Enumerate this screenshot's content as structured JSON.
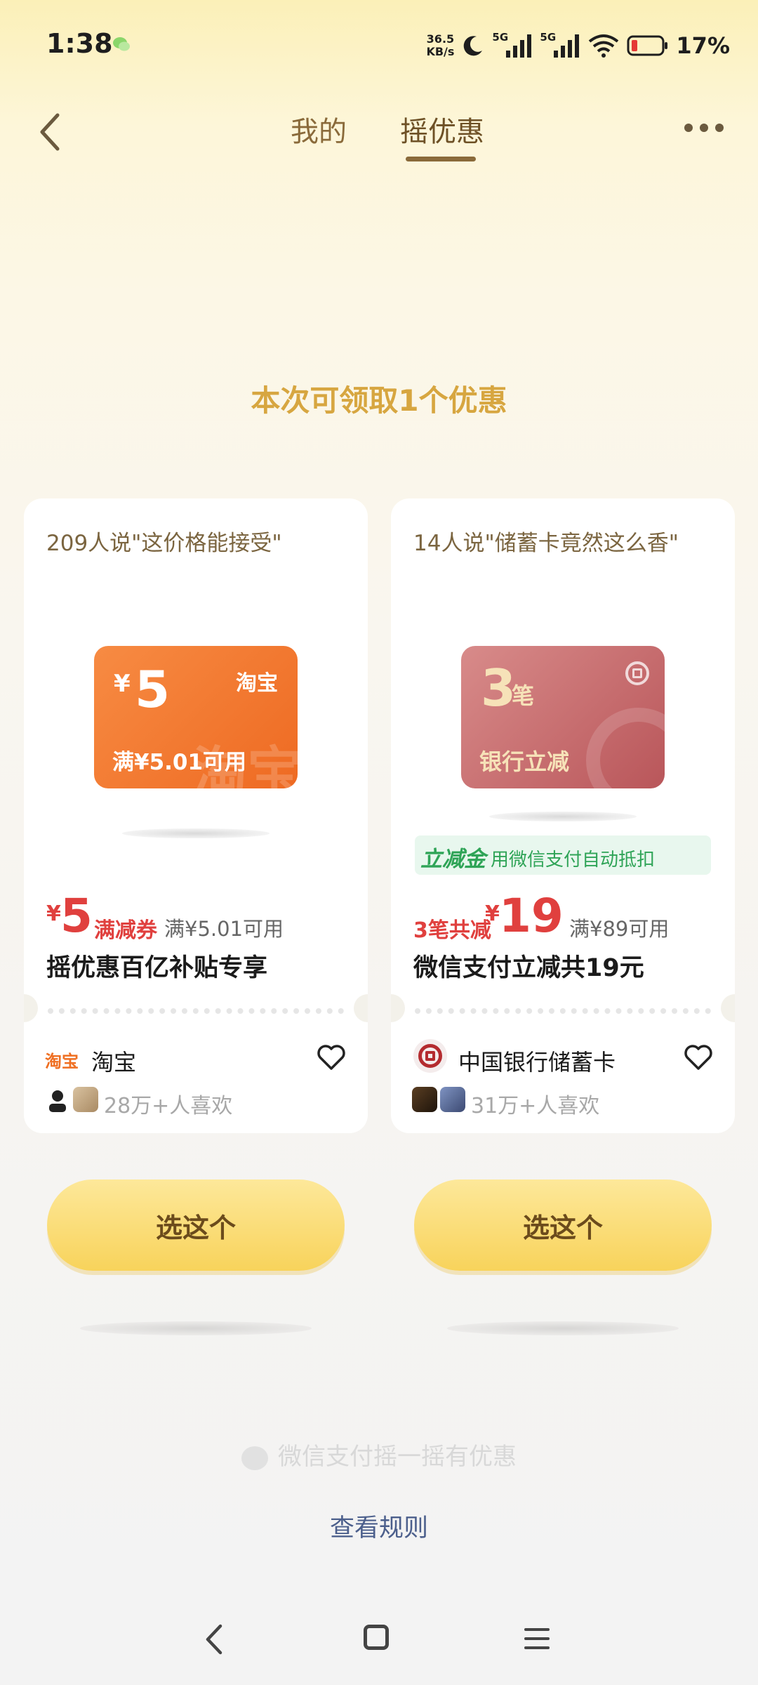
{
  "status_bar": {
    "time": "1:38",
    "net_speed_value": "36.5",
    "net_speed_unit": "KB/s",
    "sim1": "5G",
    "sim2": "5G",
    "battery": "17%"
  },
  "nav": {
    "tabs": [
      {
        "label": "我的",
        "active": false
      },
      {
        "label": "摇优惠",
        "active": true
      }
    ]
  },
  "headline": "本次可领取1个优惠",
  "cards": [
    {
      "quote": "209人说\"这价格能接受\"",
      "coupon": {
        "yen": "¥",
        "amount": "5",
        "brand": "淘宝",
        "condition": "满¥5.01可用",
        "watermark": "淘宝",
        "color": "#f07a30"
      },
      "price": {
        "yen": "¥",
        "amount": "5",
        "kind": "满减券",
        "condition": "满¥5.01可用"
      },
      "title": "摇优惠百亿补贴专享",
      "brand_icon_text": "淘宝",
      "brand_name": "淘宝",
      "likes": "28万+人喜欢",
      "button": "选这个"
    },
    {
      "quote": "14人说\"储蓄卡竟然这么香\"",
      "coupon": {
        "number": "3",
        "unit": "笔",
        "label": "银行立减",
        "color": "#c0676a"
      },
      "tag": {
        "strong": "立减金",
        "text": "用微信支付自动抵扣"
      },
      "price": {
        "prefix": "3笔共减",
        "yen": "¥",
        "amount": "19",
        "condition": "满¥89可用"
      },
      "title": "微信支付立减共19元",
      "brand_name": "中国银行储蓄卡",
      "likes": "31万+人喜欢",
      "button": "选这个"
    }
  ],
  "footer": {
    "brand": "微信支付摇一摇有优惠",
    "rules": "查看规则"
  },
  "colors": {
    "accent_gold": "#d7a640",
    "price_red": "#e0403e",
    "green": "#2fa457",
    "button_yellow": "#f8d35b",
    "link_blue": "#4c5f8c"
  }
}
